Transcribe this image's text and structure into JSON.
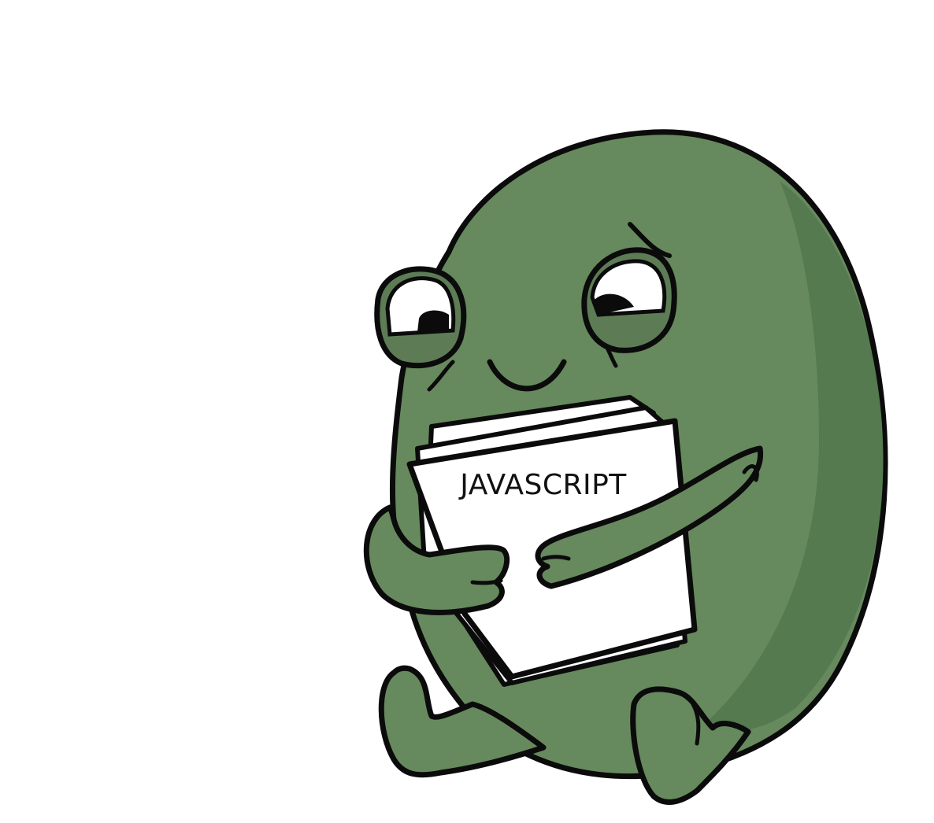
{
  "illustration": {
    "subject": "green-frog-character",
    "paper_label": "JAVASCRIPT",
    "colors": {
      "background": "#ffffff",
      "body_green": "#67895e",
      "body_shadow": "#557a4f",
      "eyelid_green": "#5d7c56",
      "outline": "#0b0b0b",
      "eye_white": "#ffffff",
      "paper": "#ffffff"
    }
  }
}
